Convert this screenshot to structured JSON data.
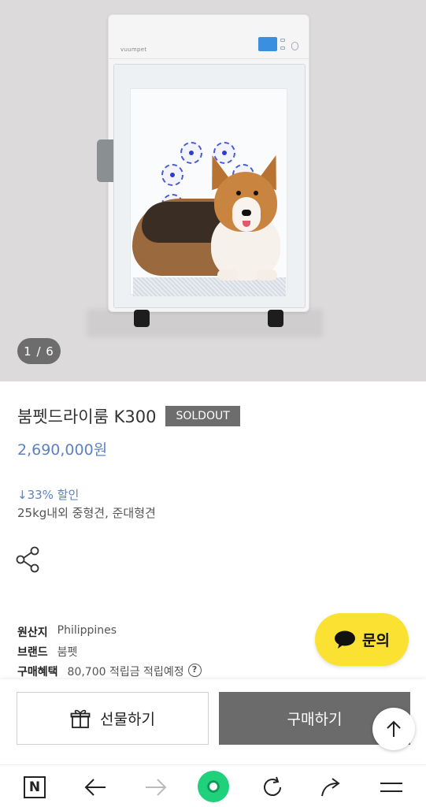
{
  "gallery": {
    "brand_mark": "vuumpet",
    "counter": "1 / 6"
  },
  "product": {
    "title": "붐펫드라이룸 K300",
    "status_badge": "SOLDOUT",
    "price": "2,690,000원",
    "discount": "↓33% 할인",
    "subtitle": "25kg내외 중형견, 준대형견"
  },
  "details": {
    "origin_label": "원산지",
    "origin_value": "Philippines",
    "brand_label": "브랜드",
    "brand_value": "붐펫",
    "benefit_label": "구매혜택",
    "benefit_value": "80,700 적립금 적립예정",
    "help_glyph": "?"
  },
  "inquiry": {
    "label": "문의",
    "color": "#fbe232"
  },
  "actions": {
    "gift_label": "선물하기",
    "buy_label": "구매하기",
    "buy_color": "#6b6b6b"
  },
  "browser_nav": {
    "home_letter": "N",
    "items": [
      "naver-home-icon",
      "back-arrow-icon",
      "forward-arrow-icon",
      "green-dot-icon",
      "refresh-icon",
      "share-arrow-icon",
      "menu-icon"
    ]
  },
  "colors": {
    "accent": "#5d82c2",
    "hero_bg": "#dcdadb"
  }
}
